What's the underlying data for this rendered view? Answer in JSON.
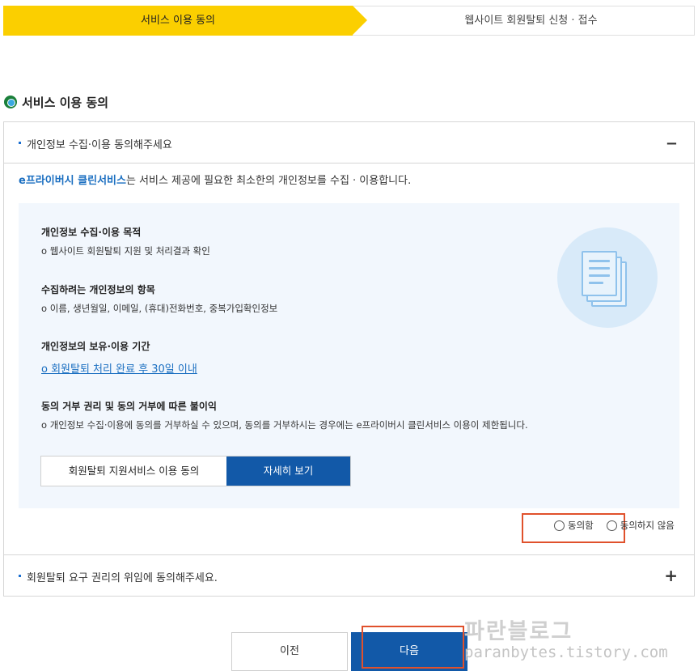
{
  "steps": {
    "step1": "서비스 이용 동의",
    "step2": "웹사이트 회원탈퇴 신청 · 접수"
  },
  "section": {
    "title": "서비스 이용 동의"
  },
  "accordion1": {
    "header": "개인정보 수집·이용 동의해주세요",
    "intro_brand": "e프라이버시 클린서비스",
    "intro_rest": "는 서비스 제공에 필요한 최소한의 개인정보를 수집 · 이용합니다.",
    "blocks": [
      {
        "heading": "개인정보 수집·이용 목적",
        "detail": "o 웹사이트 회원탈퇴 지원 및 처리결과 확인"
      },
      {
        "heading": "수집하려는 개인정보의 항목",
        "detail": "o 이름, 생년월일, 이메일, (휴대)전화번호, 중복가입확인정보"
      },
      {
        "heading": "개인정보의 보유·이용 기간",
        "detail": "o 회원탈퇴 처리 완료 후 30일 이내"
      },
      {
        "heading": "동의 거부 권리 및 동의 거부에 따른 불이익",
        "detail": "o 개인정보 수집·이용에 동의를 거부하실 수 있으며, 동의를 거부하시는 경우에는 e프라이버시 클린서비스 이용이 제한됩니다."
      }
    ],
    "btn_service": "회원탈퇴 지원서비스 이용 동의",
    "btn_detail": "자세히 보기",
    "radio_agree": "동의함",
    "radio_disagree": "동의하지 않음"
  },
  "accordion2": {
    "header": "회원탈퇴 요구 권리의 위임에 동의해주세요."
  },
  "footer": {
    "prev": "이전",
    "next": "다음"
  },
  "watermark": {
    "line1": "파란블로그",
    "line2": "paranbytes.tistory.com"
  },
  "icons": {
    "section_dot": "circle-bullet-icon",
    "documents": "documents-icon",
    "collapse": "minus-icon",
    "expand": "plus-icon"
  },
  "colors": {
    "step_active": "#fbcf00",
    "primary": "#1259a8",
    "link": "#1b6fc1",
    "highlight_box": "#e0512c"
  }
}
